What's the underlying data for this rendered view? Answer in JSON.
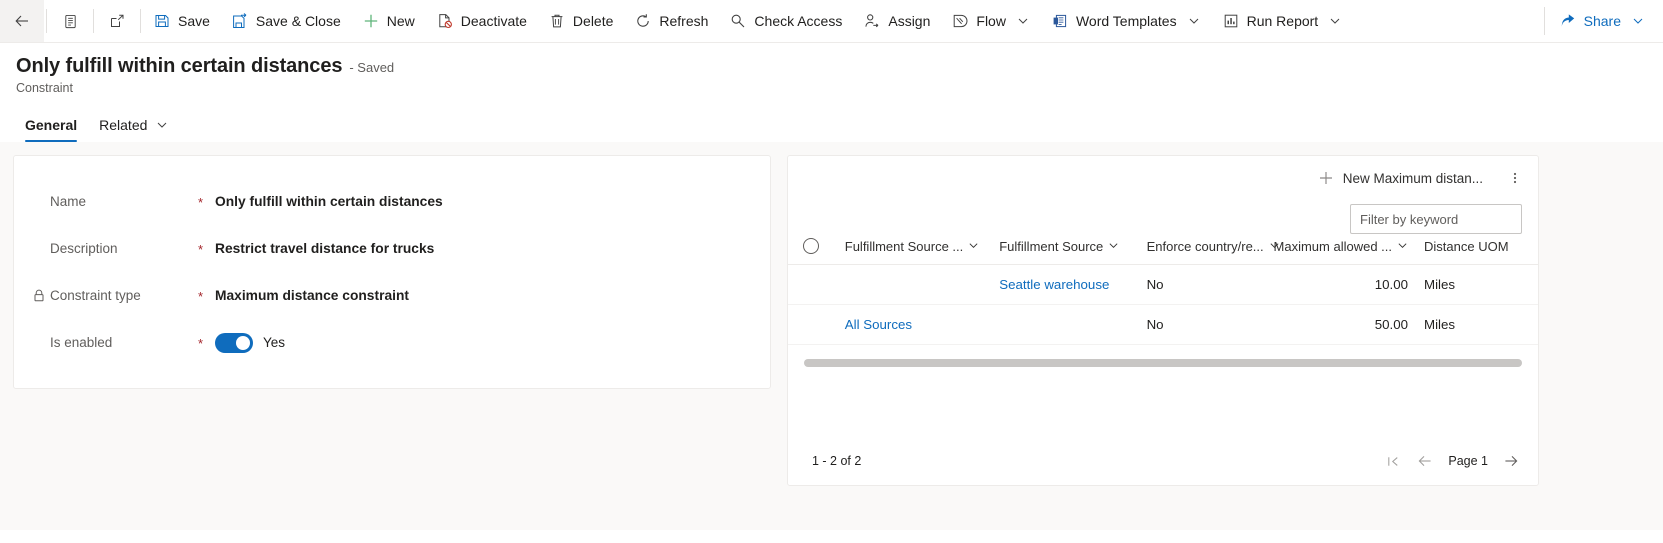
{
  "commandbar": {
    "back_icon": "back-arrow-icon",
    "form_selector_icon": "form-list-icon",
    "popout_icon": "open-in-new-window-icon",
    "buttons": [
      {
        "label": "Save",
        "icon": "save-icon"
      },
      {
        "label": "Save & Close",
        "icon": "save-and-close-icon"
      },
      {
        "label": "New",
        "icon": "plus-icon"
      },
      {
        "label": "Deactivate",
        "icon": "deactivate-icon"
      },
      {
        "label": "Delete",
        "icon": "trash-icon"
      },
      {
        "label": "Refresh",
        "icon": "refresh-icon"
      },
      {
        "label": "Check Access",
        "icon": "key-icon"
      },
      {
        "label": "Assign",
        "icon": "assign-person-icon"
      },
      {
        "label": "Flow",
        "icon": "flow-icon",
        "caret": true
      },
      {
        "label": "Word Templates",
        "icon": "word-template-icon",
        "caret": true
      },
      {
        "label": "Run Report",
        "icon": "report-icon",
        "caret": true
      }
    ],
    "share": {
      "label": "Share",
      "icon": "share-icon",
      "caret": true
    }
  },
  "header": {
    "title": "Only fulfill within certain distances",
    "saved_status": "- Saved",
    "entity": "Constraint"
  },
  "tabs": [
    {
      "label": "General",
      "active": true,
      "caret": false
    },
    {
      "label": "Related",
      "active": false,
      "caret": true
    }
  ],
  "form": {
    "fields": [
      {
        "label": "Name",
        "required": "*",
        "value": "Only fulfill within certain distances",
        "locked": false,
        "type": "text"
      },
      {
        "label": "Description",
        "required": "*",
        "value": "Restrict travel distance for trucks",
        "locked": false,
        "type": "text"
      },
      {
        "label": "Constraint type",
        "required": "*",
        "value": "Maximum distance constraint",
        "locked": true,
        "lock_icon": "lock-icon",
        "type": "text"
      },
      {
        "label": "Is enabled",
        "required": "*",
        "value": "Yes",
        "locked": false,
        "type": "toggle",
        "toggle_on": true
      }
    ]
  },
  "subgrid": {
    "new_record_label": "New Maximum distan...",
    "new_record_icon": "plus-icon",
    "more_commands_icon": "kebab-menu-icon",
    "filter": {
      "placeholder": "Filter by keyword",
      "value": ""
    },
    "select_all_icon": "select-all-circle-icon",
    "columns": [
      {
        "label": "Fulfillment Source ...",
        "sortable": true,
        "align": "left"
      },
      {
        "label": "Fulfillment Source",
        "sortable": true,
        "align": "left"
      },
      {
        "label": "Enforce country/re...",
        "sortable": true,
        "align": "left"
      },
      {
        "label": "Maximum allowed ...",
        "sortable": true,
        "align": "right"
      },
      {
        "label": "Distance UOM",
        "sortable": false,
        "align": "left"
      }
    ],
    "rows": [
      {
        "fulfillment_source_group": "",
        "fulfillment_source": "Seattle warehouse",
        "fulfillment_source_is_link": true,
        "enforce_country": "No",
        "maximum_allowed": "10.00",
        "distance_uom": "Miles"
      },
      {
        "fulfillment_source_group": "All Sources",
        "fulfillment_source_group_is_link": true,
        "fulfillment_source": "",
        "enforce_country": "No",
        "maximum_allowed": "50.00",
        "distance_uom": "Miles"
      }
    ],
    "footer": {
      "record_count": "1 - 2 of 2",
      "page_label": "Page 1",
      "first_page_icon": "first-page-icon",
      "prev_page_icon": "previous-page-icon",
      "next_page_icon": "next-page-icon"
    }
  },
  "colors": {
    "accent": "#0f6cbd",
    "required": "#a4262c",
    "canvas": "#faf9f8",
    "border": "#edebe9"
  }
}
